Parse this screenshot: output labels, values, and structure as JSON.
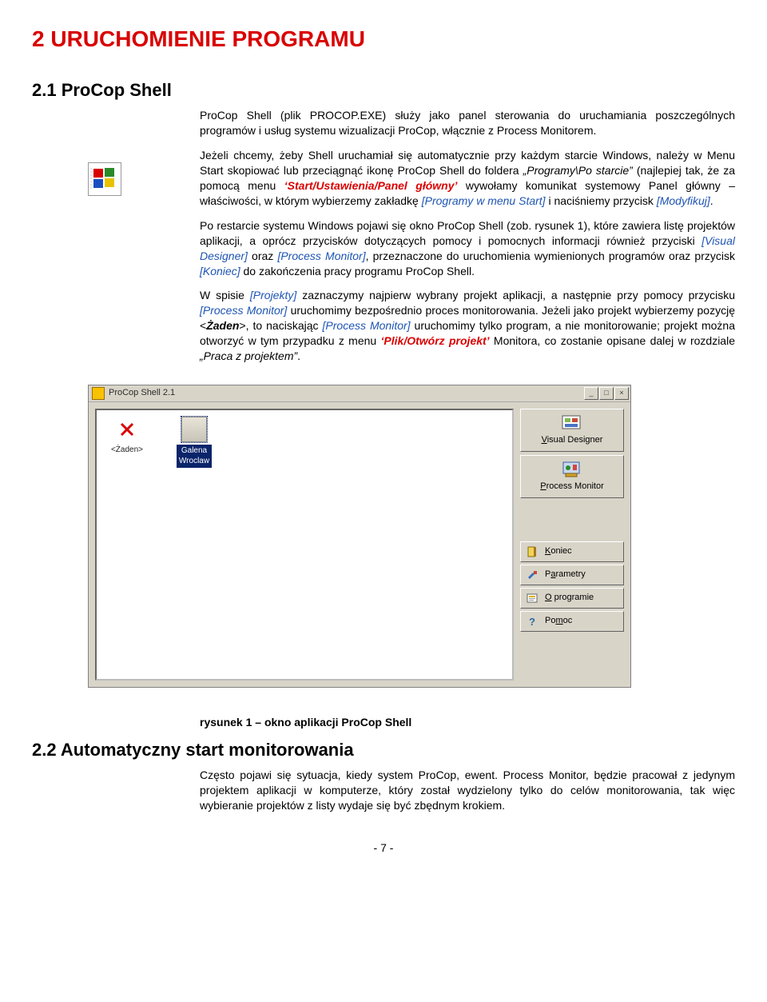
{
  "chapter_title": "2 URUCHOMIENIE PROGRAMU",
  "section21_title": "2.1 ProCop Shell",
  "p1_a": "ProCop Shell (plik PROCOP.EXE) służy jako panel sterowania do uruchamiania poszczególnych programów i usług systemu wizualizacji ProCop, włącznie z Process Monitorem.",
  "p2_a": "Jeżeli chcemy, żeby Shell uruchamiał się automatycznie przy każdym starcie Windows, należy w Menu Start skopiować lub przeciągnąć ikonę ProCop Shell do foldera ",
  "p2_q1": "„Programy\\Po starcie”",
  "p2_b": " (najlepiej tak, że za pomocą menu ",
  "p2_em1": "‘Start/Ustawienia/Panel główny’",
  "p2_c": " wywołamy komunikat systemowy Panel główny – właściwości, w którym wybierzemy zakładkę ",
  "p2_ref1": "[Programy w menu Start]",
  "p2_d": " i naciśniemy przycisk ",
  "p2_ref2": "[Modyfikuj]",
  "p2_e": ".",
  "p3_a": "Po restarcie systemu Windows pojawi się okno ProCop Shell (zob. rysunek 1), które zawiera listę projektów aplikacji, a oprócz przycisków dotyczących pomocy i pomocnych informacji również przyciski ",
  "p3_ref1": "[Visual Designer]",
  "p3_b": " oraz ",
  "p3_ref2": "[Process Monitor]",
  "p3_c": ", przeznaczone do uruchomienia wymienionych programów oraz przycisk ",
  "p3_ref3": "[Koniec]",
  "p3_d": " do zakończenia pracy programu ProCop Shell.",
  "p4_a": "W spisie ",
  "p4_ref1": "[Projekty]",
  "p4_b": " zaznaczymy najpierw wybrany projekt aplikacji, a następnie przy pomocy przycisku ",
  "p4_ref2": "[Process Monitor]",
  "p4_c": " uruchomimy bezpośrednio proces monitorowania. Jeżeli jako projekt wybierzemy pozycję <",
  "p4_bold": "Żaden",
  "p4_d": ">, to naciskając ",
  "p4_ref3": "[Process Monitor]",
  "p4_e": " uruchomimy tylko program, a nie monitorowanie; projekt można otworzyć w tym przypadku z menu ",
  "p4_em1": "‘Plik/Otwórz projekt’",
  "p4_f": " Monitora, co zostanie opisane dalej w rozdziale ",
  "p4_q1": "„Praca z projektem”",
  "p4_g": ".",
  "screenshot": {
    "title": "ProCop Shell 2.1",
    "projects": {
      "none_label": "<Żaden>",
      "item1_line1": "Galena",
      "item1_line2": "Wroclaw"
    },
    "buttons": {
      "visual_designer": "Visual Designer",
      "process_monitor": "Process Monitor",
      "koniec": "Koniec",
      "parametry": "Parametry",
      "oprogramie": "O programie",
      "pomoc": "Pomoc"
    }
  },
  "caption": "rysunek 1 – okno aplikacji ProCop Shell",
  "section22_title": "2.2 Automatyczny start monitorowania",
  "p5": "Często pojawi się sytuacja, kiedy system ProCop, ewent. Process Monitor, będzie pracował z jedynym projektem aplikacji w komputerze, który został wydzielony tylko do celów monitorowania, tak więc wybieranie projektów z listy wydaje się być zbędnym krokiem.",
  "page_number": "- 7 -"
}
